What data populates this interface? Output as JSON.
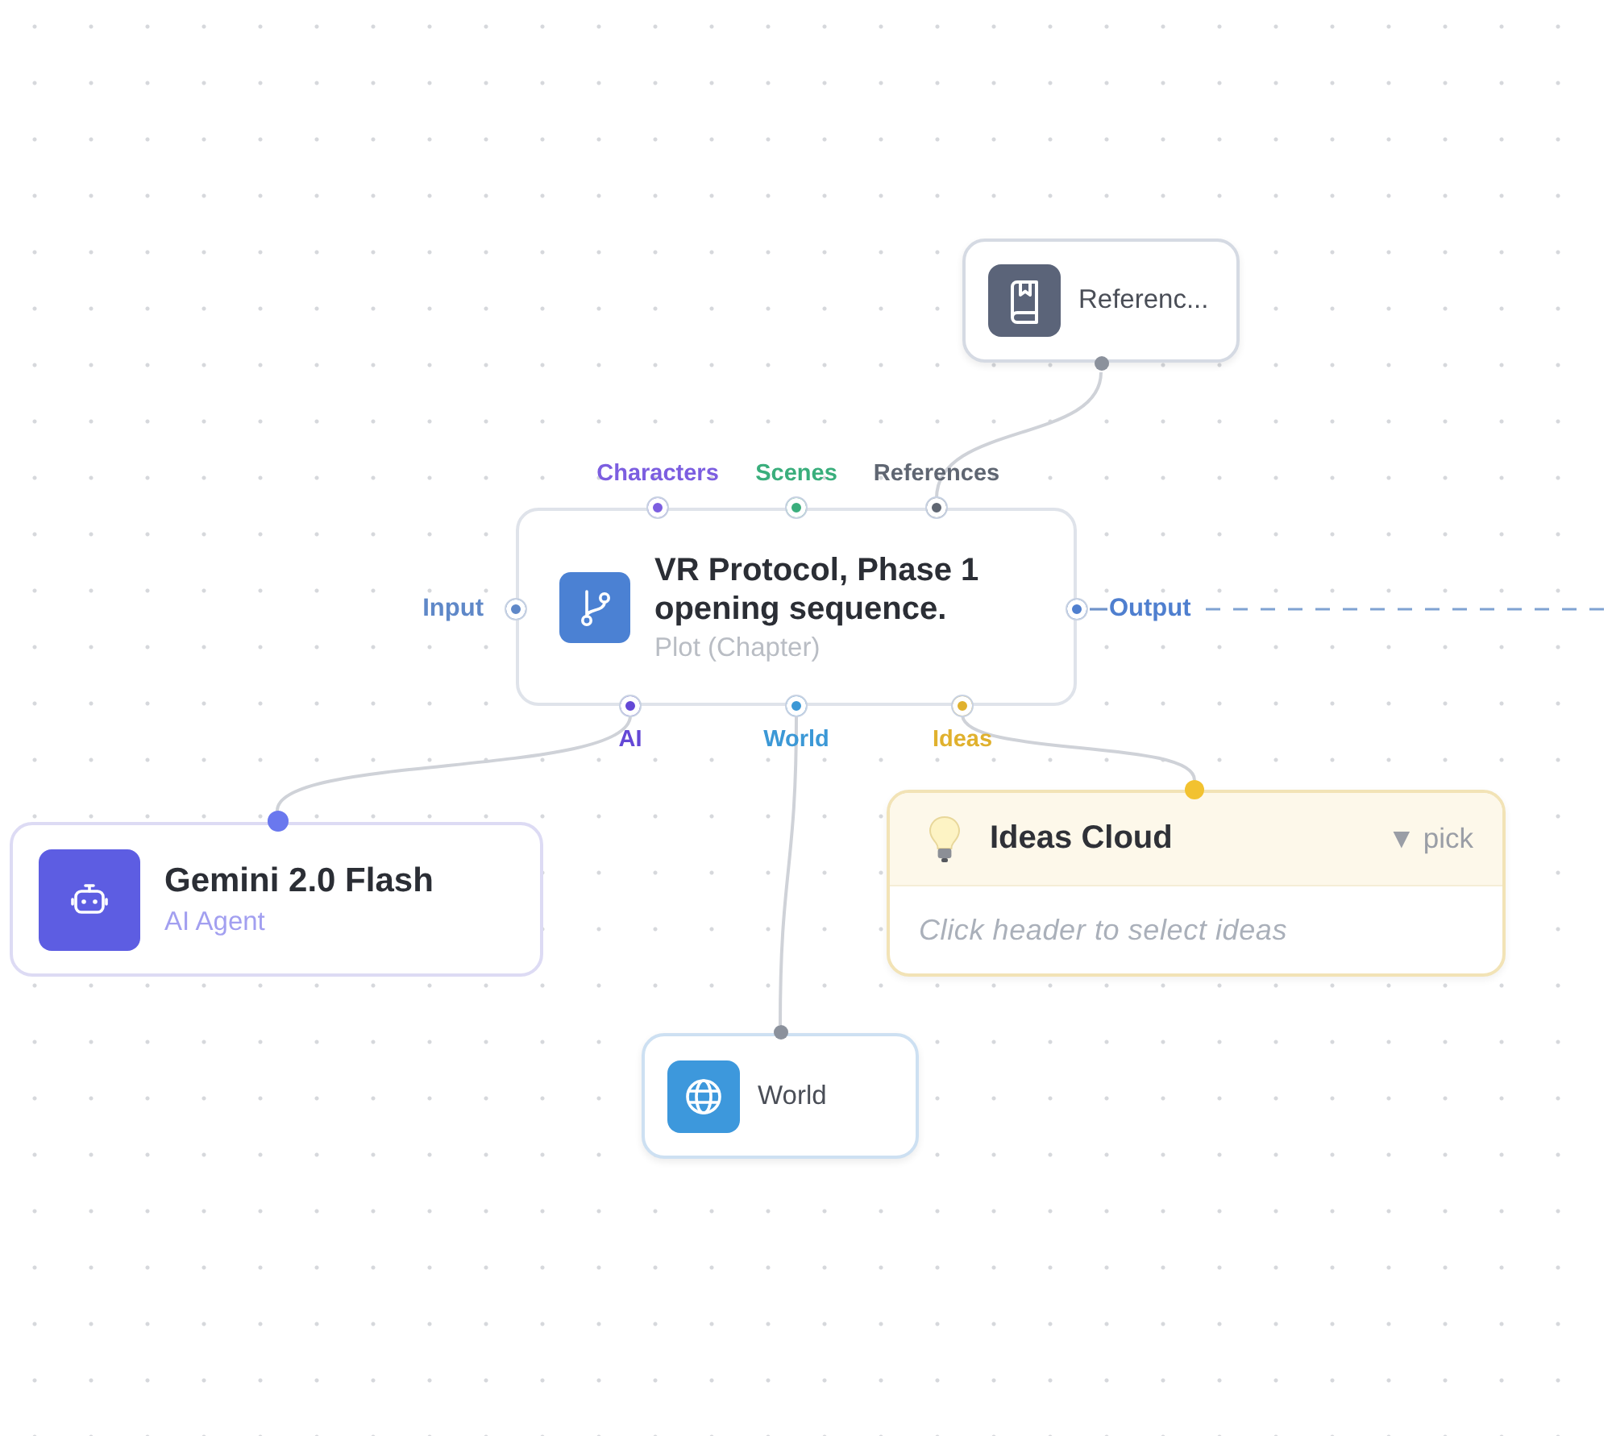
{
  "canvas": {
    "nodes": [
      {
        "kind": "reference",
        "title": "Referenc..."
      },
      {
        "kind": "plot",
        "title": "VR Protocol, Phase 1 opening sequence.",
        "subtitle": "Plot (Chapter)",
        "top_ports": [
          {
            "label": "Characters",
            "color": "#7c5ee0"
          },
          {
            "label": "Scenes",
            "color": "#3aae7c"
          },
          {
            "label": "References",
            "color": "#5f6672"
          }
        ],
        "left_ports": [
          {
            "label": "Input",
            "color": "#5f88c8"
          }
        ],
        "right_ports": [
          {
            "label": "Output",
            "color": "#4f7fcf"
          }
        ],
        "bottom_ports": [
          {
            "label": "AI",
            "color": "#6448d6"
          },
          {
            "label": "World",
            "color": "#3b98d6"
          },
          {
            "label": "Ideas",
            "color": "#e0b12e"
          }
        ]
      },
      {
        "kind": "agent",
        "title": "Gemini 2.0 Flash",
        "subtitle": "AI Agent"
      },
      {
        "kind": "ideas",
        "title": "Ideas Cloud",
        "action": "▼ pick",
        "hint": "Click header to select ideas"
      },
      {
        "kind": "world",
        "title": "World"
      }
    ]
  }
}
